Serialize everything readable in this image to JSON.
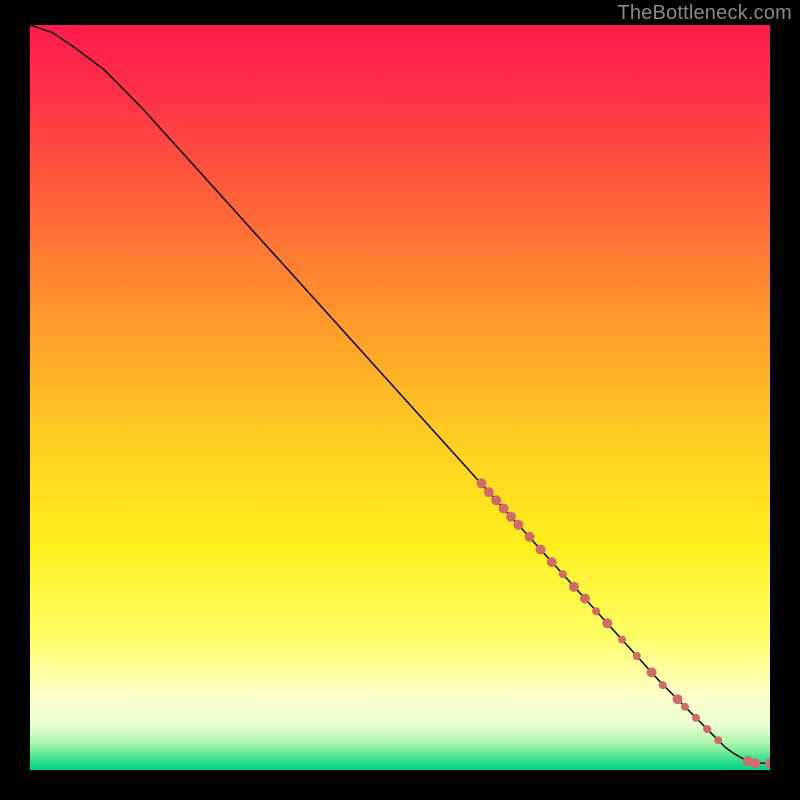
{
  "watermark": "TheBottleneck.com",
  "chart_data": {
    "type": "line",
    "title": "",
    "xlabel": "",
    "ylabel": "",
    "xlim": [
      0,
      100
    ],
    "ylim": [
      0,
      100
    ],
    "grid": false,
    "legend": false,
    "series": [
      {
        "name": "curve",
        "kind": "line",
        "color": "#000000",
        "x": [
          0,
          3,
          6,
          10,
          15,
          20,
          25,
          30,
          35,
          40,
          45,
          50,
          55,
          60,
          65,
          70,
          75,
          80,
          85,
          88,
          90,
          92,
          94,
          95,
          96,
          97,
          98,
          100
        ],
        "y": [
          100,
          99,
          97,
          94,
          89,
          83.5,
          78,
          72.5,
          67,
          61.5,
          56,
          50.5,
          45,
          39.5,
          34,
          28.5,
          23,
          17.5,
          12,
          9,
          7,
          5,
          3,
          2.3,
          1.7,
          1.2,
          0.9,
          0.9
        ]
      },
      {
        "name": "markers",
        "kind": "scatter",
        "color": "#d36a6a",
        "points": [
          {
            "x": 61.0,
            "y": 38.5,
            "r": 5
          },
          {
            "x": 62.0,
            "y": 37.3,
            "r": 5
          },
          {
            "x": 63.0,
            "y": 36.2,
            "r": 5
          },
          {
            "x": 64.0,
            "y": 35.1,
            "r": 5
          },
          {
            "x": 65.0,
            "y": 34.0,
            "r": 5
          },
          {
            "x": 66.0,
            "y": 32.9,
            "r": 5
          },
          {
            "x": 67.5,
            "y": 31.3,
            "r": 5
          },
          {
            "x": 69.0,
            "y": 29.6,
            "r": 5
          },
          {
            "x": 70.5,
            "y": 27.9,
            "r": 5
          },
          {
            "x": 72.0,
            "y": 26.3,
            "r": 4
          },
          {
            "x": 73.5,
            "y": 24.6,
            "r": 5
          },
          {
            "x": 75.0,
            "y": 23.0,
            "r": 5
          },
          {
            "x": 76.5,
            "y": 21.3,
            "r": 4
          },
          {
            "x": 78.0,
            "y": 19.7,
            "r": 5
          },
          {
            "x": 80.0,
            "y": 17.5,
            "r": 4
          },
          {
            "x": 82.0,
            "y": 15.3,
            "r": 4
          },
          {
            "x": 84.0,
            "y": 13.1,
            "r": 5
          },
          {
            "x": 85.5,
            "y": 11.4,
            "r": 4
          },
          {
            "x": 87.5,
            "y": 9.5,
            "r": 5
          },
          {
            "x": 88.5,
            "y": 8.5,
            "r": 4
          },
          {
            "x": 90.0,
            "y": 7.0,
            "r": 4
          },
          {
            "x": 91.5,
            "y": 5.5,
            "r": 4
          },
          {
            "x": 93.0,
            "y": 4.0,
            "r": 4
          },
          {
            "x": 97.0,
            "y": 1.2,
            "r": 5
          },
          {
            "x": 98.0,
            "y": 0.9,
            "r": 5
          },
          {
            "x": 100.0,
            "y": 0.9,
            "r": 5
          }
        ]
      }
    ],
    "background": {
      "type": "vertical-gradient",
      "stops": [
        {
          "offset": 0.0,
          "color": "#ff1a4d"
        },
        {
          "offset": 0.1,
          "color": "#ff3348"
        },
        {
          "offset": 0.25,
          "color": "#ff6638"
        },
        {
          "offset": 0.4,
          "color": "#ff9a2c"
        },
        {
          "offset": 0.55,
          "color": "#ffcc22"
        },
        {
          "offset": 0.7,
          "color": "#fff01e"
        },
        {
          "offset": 0.82,
          "color": "#ffff66"
        },
        {
          "offset": 0.9,
          "color": "#ffffcc"
        },
        {
          "offset": 0.94,
          "color": "#e8ffd0"
        },
        {
          "offset": 0.965,
          "color": "#a8f5a8"
        },
        {
          "offset": 0.985,
          "color": "#40e090"
        },
        {
          "offset": 1.0,
          "color": "#00d084"
        }
      ]
    }
  }
}
